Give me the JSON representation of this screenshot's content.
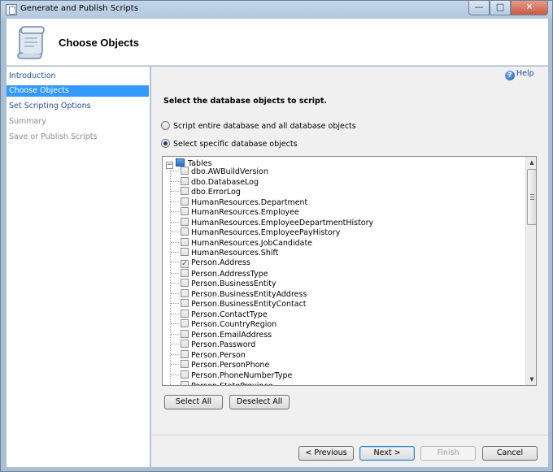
{
  "window": {
    "title": "Generate and Publish Scripts",
    "min_glyph": "—",
    "max_glyph": "□",
    "close_glyph": "✕"
  },
  "header": {
    "title": "Choose Objects",
    "icon": "scroll-icon"
  },
  "nav": {
    "items": [
      {
        "label": "Introduction",
        "state": "link"
      },
      {
        "label": "Choose Objects",
        "state": "selected"
      },
      {
        "label": "Set Scripting Options",
        "state": "link"
      },
      {
        "label": "Summary",
        "state": "disabled"
      },
      {
        "label": "Save or Publish Scripts",
        "state": "disabled"
      }
    ]
  },
  "main": {
    "help_label": "Help",
    "instruction": "Select the database objects to script.",
    "radio_options": [
      {
        "label": "Script entire database and all database objects",
        "selected": false
      },
      {
        "label": "Select specific database objects",
        "selected": true
      }
    ]
  },
  "tree": {
    "root_label": "Tables",
    "items": [
      {
        "label": "dbo.AWBuildVersion",
        "checked": false
      },
      {
        "label": "dbo.DatabaseLog",
        "checked": false
      },
      {
        "label": "dbo.ErrorLog",
        "checked": false
      },
      {
        "label": "HumanResources.Department",
        "checked": false
      },
      {
        "label": "HumanResources.Employee",
        "checked": false
      },
      {
        "label": "HumanResources.EmployeeDepartmentHistory",
        "checked": false
      },
      {
        "label": "HumanResources.EmployeePayHistory",
        "checked": false
      },
      {
        "label": "HumanResources.JobCandidate",
        "checked": false
      },
      {
        "label": "HumanResources.Shift",
        "checked": false
      },
      {
        "label": "Person.Address",
        "checked": true
      },
      {
        "label": "Person.AddressType",
        "checked": false
      },
      {
        "label": "Person.BusinessEntity",
        "checked": false
      },
      {
        "label": "Person.BusinessEntityAddress",
        "checked": false
      },
      {
        "label": "Person.BusinessEntityContact",
        "checked": false
      },
      {
        "label": "Person.ContactType",
        "checked": false
      },
      {
        "label": "Person.CountryRegion",
        "checked": false
      },
      {
        "label": "Person.EmailAddress",
        "checked": false
      },
      {
        "label": "Person.Password",
        "checked": false
      },
      {
        "label": "Person.Person",
        "checked": false
      },
      {
        "label": "Person.PersonPhone",
        "checked": false
      },
      {
        "label": "Person.PhoneNumberType",
        "checked": false
      },
      {
        "label": "Person.StateProvince",
        "checked": false
      }
    ]
  },
  "buttons": {
    "select_all": "Select All",
    "deselect_all": "Deselect All",
    "previous": "< Previous",
    "next": "Next >",
    "finish": "Finish",
    "cancel": "Cancel"
  },
  "colors": {
    "selected_nav": "#3399ff",
    "link": "#1f4f9a",
    "frame": "#a9bfd6"
  }
}
